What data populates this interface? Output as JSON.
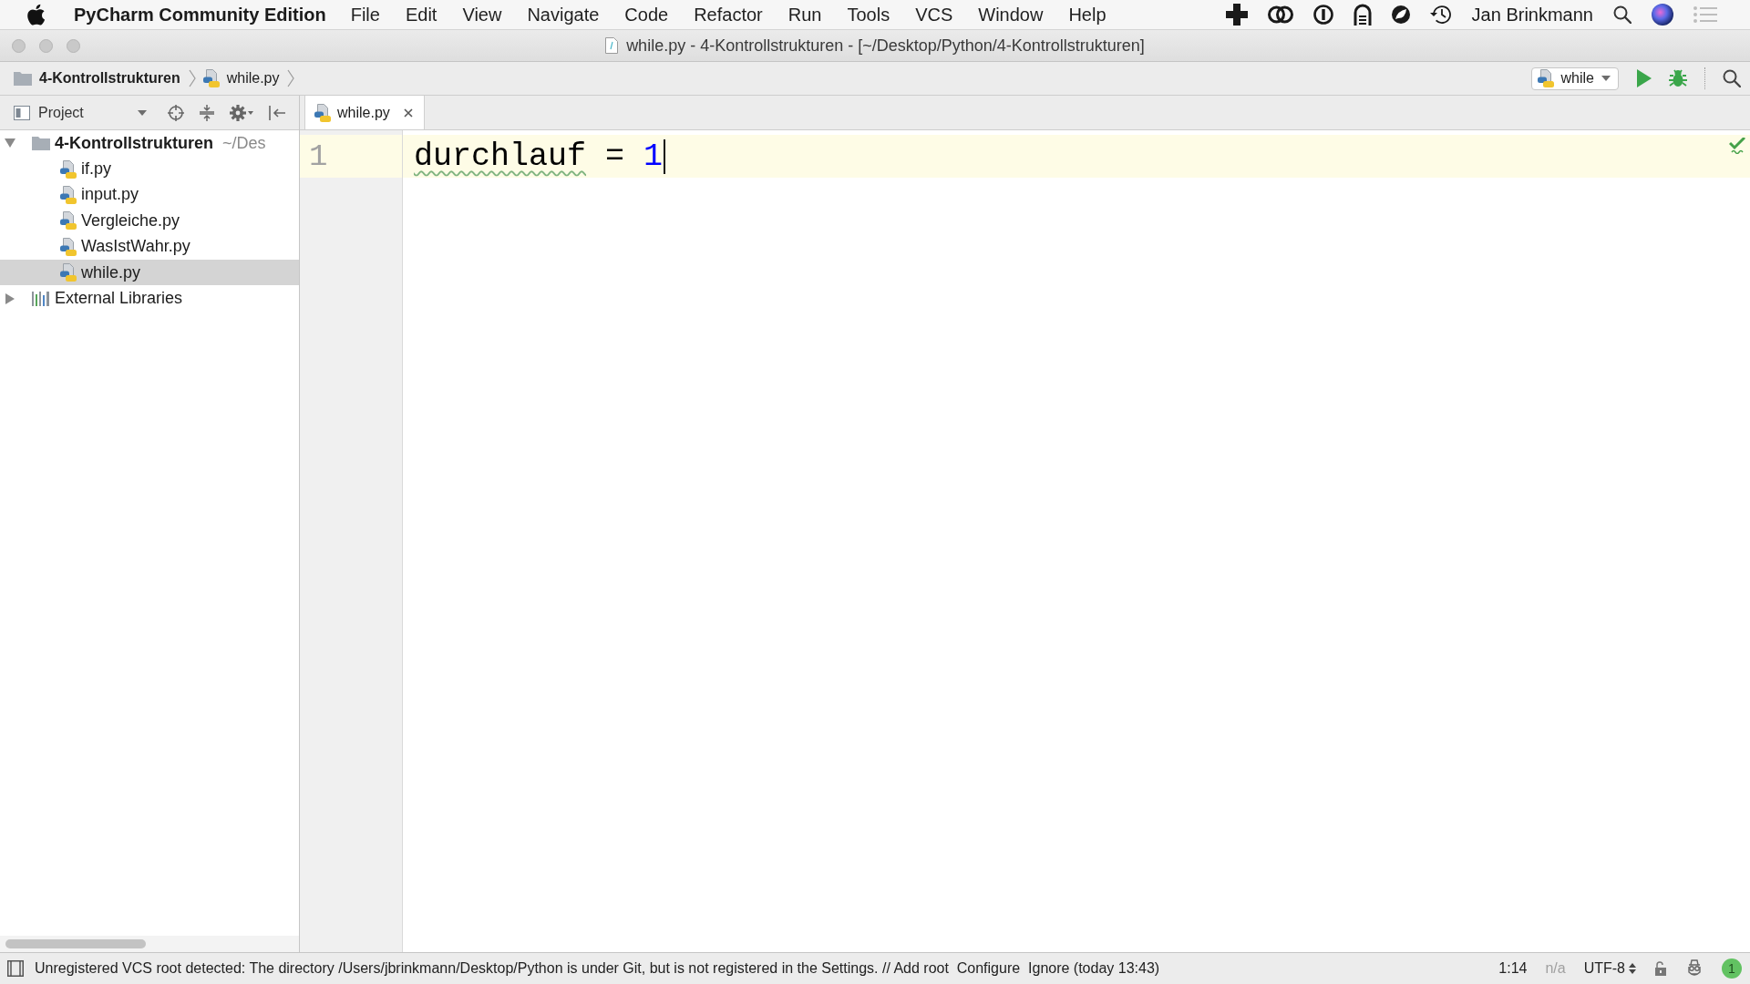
{
  "menu_bar": {
    "app_name": "PyCharm Community Edition",
    "items": [
      "File",
      "Edit",
      "View",
      "Navigate",
      "Code",
      "Refactor",
      "Run",
      "Tools",
      "VCS",
      "Window",
      "Help"
    ],
    "user": "Jan Brinkmann"
  },
  "window": {
    "title": "while.py - 4-Kontrollstrukturen - [~/Desktop/Python/4-Kontrollstrukturen]"
  },
  "navigation_bar": {
    "breadcrumbs": [
      {
        "label": "4-Kontrollstrukturen",
        "kind": "folder"
      },
      {
        "label": "while.py",
        "kind": "python-file"
      }
    ],
    "run_configuration": "while"
  },
  "project_panel": {
    "title": "Project",
    "tree": [
      {
        "label": "4-Kontrollstrukturen",
        "hint": "~/Des",
        "kind": "folder",
        "expanded": true,
        "selected": false,
        "children": [
          {
            "label": "if.py",
            "kind": "python-file",
            "selected": false
          },
          {
            "label": "input.py",
            "kind": "python-file",
            "selected": false
          },
          {
            "label": "Vergleiche.py",
            "kind": "python-file",
            "selected": false
          },
          {
            "label": "WasIstWahr.py",
            "kind": "python-file",
            "selected": false
          },
          {
            "label": "while.py",
            "kind": "python-file",
            "selected": true
          }
        ]
      },
      {
        "label": "External Libraries",
        "kind": "library",
        "expanded": false,
        "selected": false
      }
    ]
  },
  "editor": {
    "tabs": [
      {
        "label": "while.py",
        "selected": true
      }
    ],
    "lines": [
      {
        "number": "1",
        "current": true,
        "tokens": [
          {
            "text": "durchlauf",
            "kind": "name",
            "typo": true
          },
          {
            "text": " = ",
            "kind": "operator",
            "typo": false
          },
          {
            "text": "1",
            "kind": "number",
            "typo": false
          }
        ]
      }
    ]
  },
  "status_bar": {
    "message": "Unregistered VCS root detected: The directory /Users/jbrinkmann/Desktop/Python is under Git, but is not registered in the Settings. // Add root  Configure  Ignore (today 13:43)",
    "position": "1:14",
    "line_separator": "n/a",
    "encoding": "UTF-8",
    "event_count": "1"
  }
}
